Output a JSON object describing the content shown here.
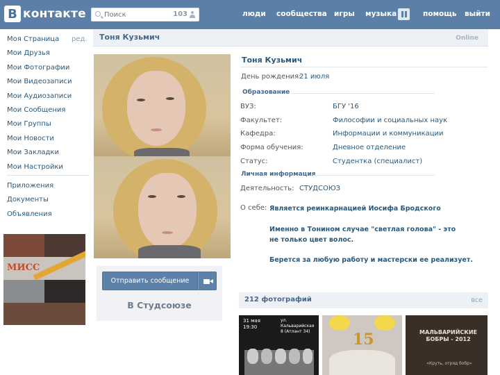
{
  "brand": {
    "letter": "В",
    "name": "контакте"
  },
  "search": {
    "placeholder": "Поиск",
    "count": "103"
  },
  "topnav": [
    "люди",
    "сообщества",
    "игры",
    "музыка",
    "помощь",
    "выйти"
  ],
  "menu": {
    "edit": "ред.",
    "main": [
      "Моя Страница",
      "Мои Друзья",
      "Мои Фотографии",
      "Мои Видеозаписи",
      "Мои Аудиозаписи",
      "Мои Сообщения",
      "Мои Группы",
      "Мои Новости",
      "Мои Закладки",
      "Мои Настройки"
    ],
    "extra": [
      "Приложения",
      "Документы",
      "Объявления"
    ]
  },
  "ad": {
    "text": "МИСС"
  },
  "profile": {
    "header_name": "Тоня Кузьмич",
    "status_online": "Online",
    "full_name": "Тоня Кузьмич",
    "birthday_label": "День рождения:",
    "birthday_value": "21 июля",
    "education_title": "Образование",
    "education": [
      {
        "label": "ВУЗ:",
        "value": "БГУ '16"
      },
      {
        "label": "Факультет:",
        "value": "Философии и социальных наук"
      },
      {
        "label": "Кафедра:",
        "value": "Информации и коммуникации"
      },
      {
        "label": "Форма обучения:",
        "value": "Дневное отделение"
      },
      {
        "label": "Статус:",
        "value": "Студентка (специалист)"
      }
    ],
    "personal_title": "Личная информация",
    "activity_label": "Деятельность:",
    "activity_value": "СТУДСОЮЗ",
    "about_label": "О себе:",
    "about": [
      "Является реинкарнацией Иосифа Бродского",
      "Именно в Тонином случае \"светлая голова\" - это не только цвет волос.",
      "Берется за любую работу и мастерски ее реализует."
    ],
    "send_message": "Отправить сообщение",
    "in_studsoyuz": "В Студсоюзе"
  },
  "photos": {
    "title": "212 фотографий",
    "all": "все",
    "thumbs": [
      {
        "caption1": "31 мая 19:30",
        "caption2": "ул. Кальварийская 8 (Атлант 34)"
      },
      {
        "caption1": "15",
        "caption2": ""
      },
      {
        "caption1": "МАЛЬВАРИЙСКИЕ БОБРЫ - 2012",
        "caption2": "«Круть, отряд бобр»"
      }
    ]
  },
  "colors": {
    "header": "#5b7fa6",
    "link": "#2b587a",
    "accent": "#45688e"
  }
}
